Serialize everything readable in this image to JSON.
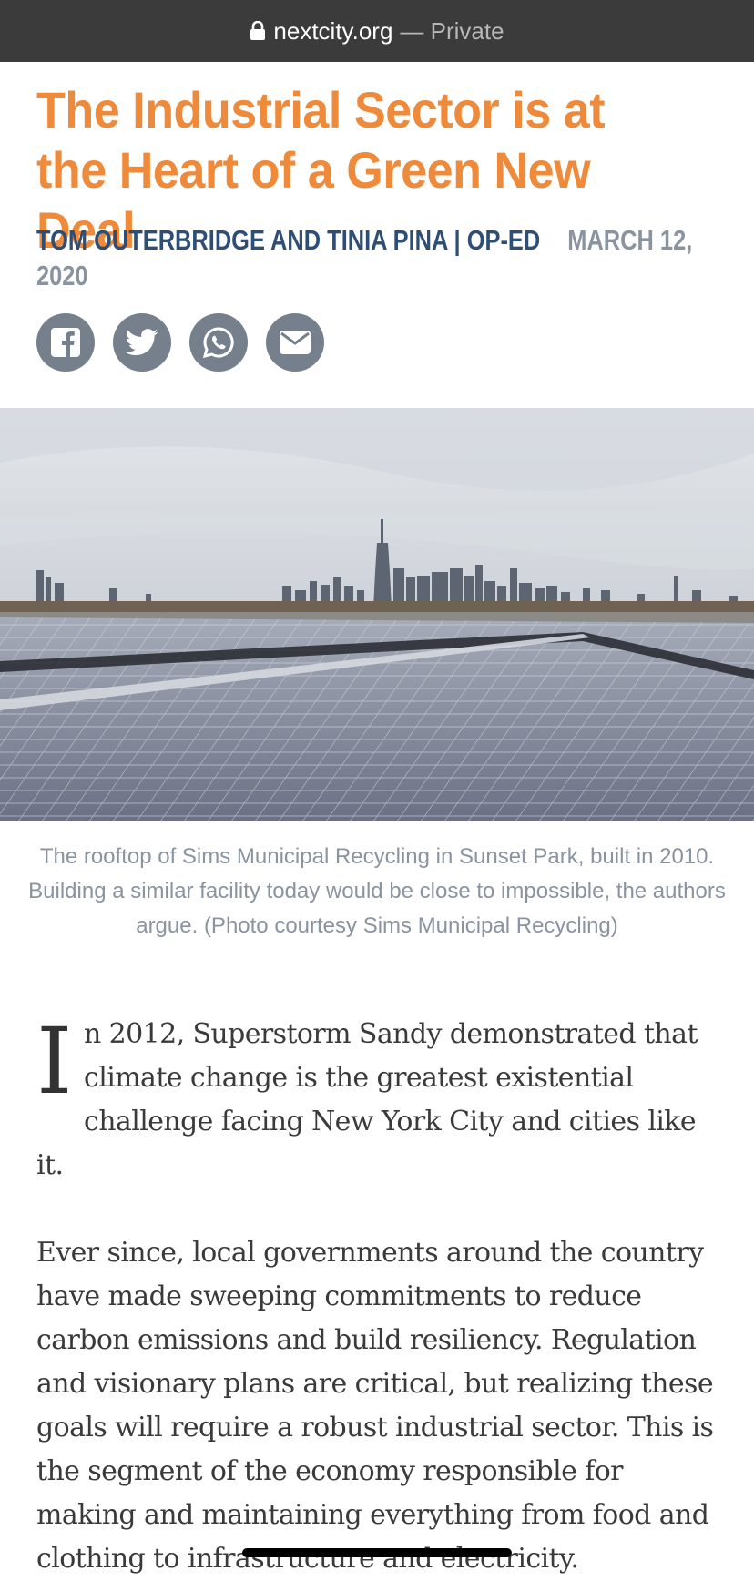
{
  "browser": {
    "domain": "nextcity.org",
    "separator": "—",
    "status": "Private"
  },
  "article": {
    "title": "The Industrial Sector is at the Heart of a Green New Deal",
    "authors": "Tom Outerbridge and Tinia Pina",
    "section_sep": "|",
    "section": "Op-Ed",
    "date": "March 12, 2020",
    "share_icons": [
      "facebook-icon",
      "twitter-icon",
      "whatsapp-icon",
      "email-icon"
    ],
    "photo_caption": "The rooftop of Sims Municipal Recycling in Sunset Park, built in 2010. Building a similar facility today would be close to impossible, the authors argue. (Photo courtesy Sims Municipal Recycling)",
    "dropcap": "I",
    "paragraph1_rest": "n 2012, Superstorm Sandy demonstrated that climate change is the greatest existential challenge facing New York City and cities like it.",
    "paragraph2": "Ever since, local governments around the country have made sweeping commitments to reduce carbon emissions and build resiliency. Regulation and visionary plans are critical, but realizing these goals will require a robust industrial sector. This is the segment of the economy responsible for making and maintaining everything from food and clothing to infrastructure and electricity."
  },
  "colors": {
    "title": "#ef8a3a",
    "byline": "#2d4e76",
    "muted": "#8a93a0",
    "share_button": "#767f8c",
    "urlbar": "#3b3b3b"
  }
}
